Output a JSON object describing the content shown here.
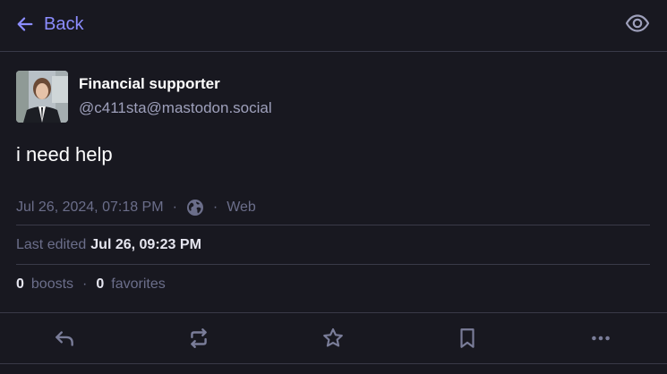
{
  "header": {
    "back_label": "Back",
    "back_icon": "arrow-left-icon",
    "visibility_icon": "eye-icon"
  },
  "status": {
    "account": {
      "display_name": "Financial supporter",
      "acct": "@c411sta@mastodon.social"
    },
    "content": "i need help",
    "meta": {
      "timestamp": "Jul 26, 2024, 07:18 PM",
      "separator": "·",
      "visibility_icon": "globe-icon",
      "application": "Web"
    },
    "edited": {
      "label": "Last edited",
      "timestamp": "Jul 26, 09:23 PM"
    },
    "counts": {
      "boosts_count": "0",
      "boosts_label": "boosts",
      "favorites_count": "0",
      "favorites_label": "favorites",
      "separator": "·"
    }
  },
  "actions": [
    {
      "name": "reply",
      "icon": "reply-icon"
    },
    {
      "name": "boost",
      "icon": "boost-icon"
    },
    {
      "name": "favorite",
      "icon": "star-icon"
    },
    {
      "name": "bookmark",
      "icon": "bookmark-icon"
    },
    {
      "name": "more",
      "icon": "more-icon"
    }
  ],
  "colors": {
    "background": "#181820",
    "accent": "#8c8dff",
    "border": "#393a48",
    "muted": "#6b6e8a",
    "secondary_text": "#9ea0bb",
    "primary_text": "#ffffff",
    "icon": "#7a7d99"
  }
}
